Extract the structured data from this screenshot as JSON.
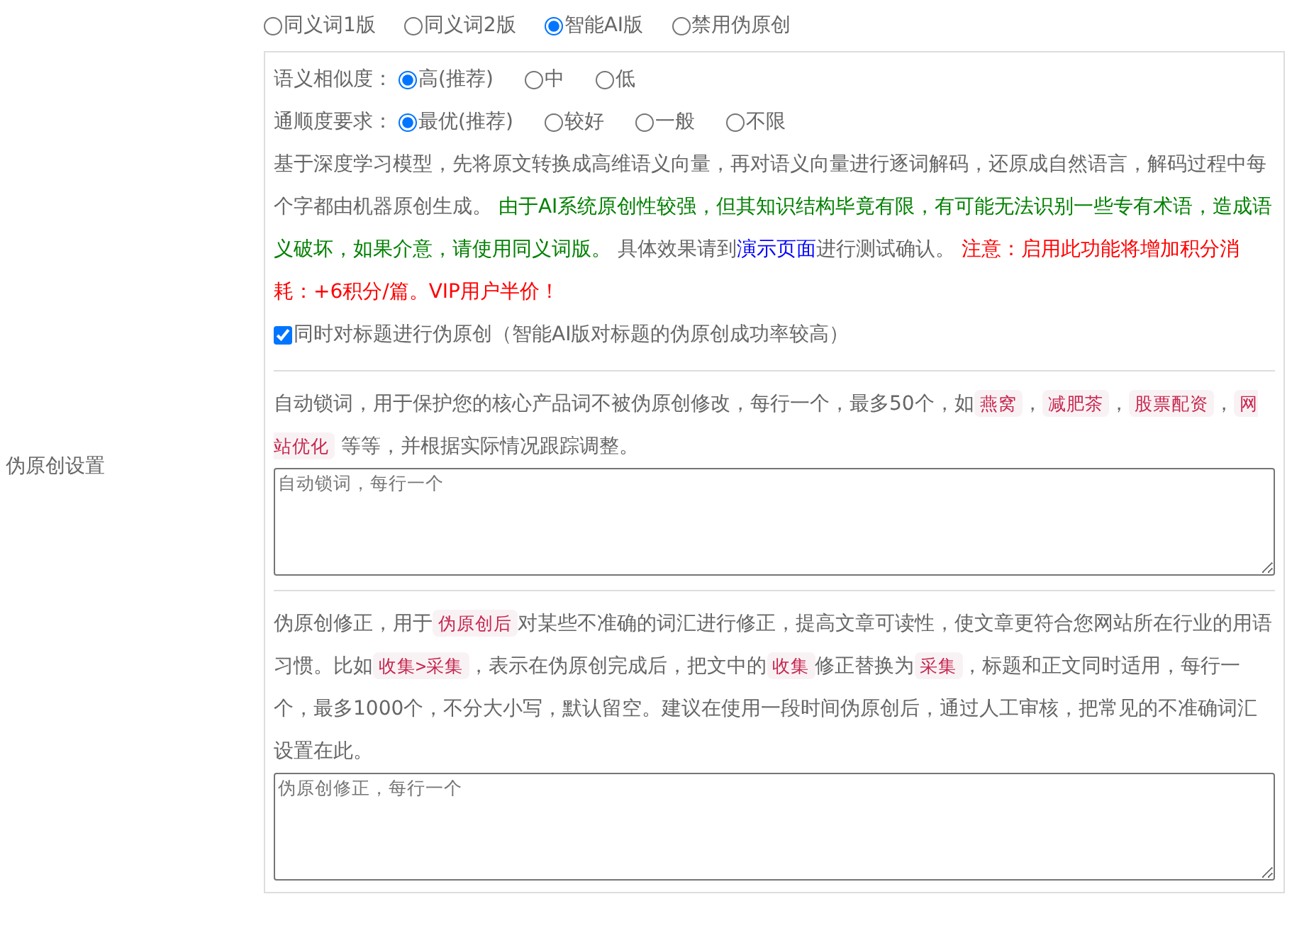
{
  "settings_label": "伪原创设置",
  "modes": [
    {
      "label": "同义词1版",
      "selected": false
    },
    {
      "label": "同义词2版",
      "selected": false
    },
    {
      "label": "智能AI版",
      "selected": true
    },
    {
      "label": "禁用伪原创",
      "selected": false
    }
  ],
  "similarity": {
    "label": "语义相似度：",
    "options": [
      {
        "label": "高(推荐)",
        "selected": true
      },
      {
        "label": "中",
        "selected": false
      },
      {
        "label": "低",
        "selected": false
      }
    ]
  },
  "fluency": {
    "label": "通顺度要求：",
    "options": [
      {
        "label": "最优(推荐)",
        "selected": true
      },
      {
        "label": "较好",
        "selected": false
      },
      {
        "label": "一般",
        "selected": false
      },
      {
        "label": "不限",
        "selected": false
      }
    ]
  },
  "description": [
    {
      "kind": "plain",
      "text": "基于深度学习模型，先将原文转换成高维语义向量，再对语义向量进行逐词解码，还原成自然语言，解码过程中每个字都由机器原创生成。 "
    },
    {
      "kind": "green",
      "text": "由于AI系统原创性较强，但其知识结构毕竟有限，有可能无法识别一些专有术语，造成语义破坏，如果介意，请使用同义词版。"
    },
    {
      "kind": "plain",
      "text": " 具体效果请到"
    },
    {
      "kind": "link",
      "text": "演示页面"
    },
    {
      "kind": "plain",
      "text": "进行测试确认。 "
    },
    {
      "kind": "red",
      "text": "注意：启用此功能将增加积分消耗：+6积分/篇。VIP用户半价！"
    }
  ],
  "title_option": {
    "label": "同时对标题进行伪原创（智能AI版对标题的伪原创成功率较高）",
    "checked": true
  },
  "lock_words": {
    "description": [
      {
        "kind": "plain",
        "text": "自动锁词，用于保护您的核心产品词不被伪原创修改，每行一个，最多50个，如"
      },
      {
        "kind": "code",
        "text": "燕窝"
      },
      {
        "kind": "plain",
        "text": "，"
      },
      {
        "kind": "code",
        "text": "减肥茶"
      },
      {
        "kind": "plain",
        "text": "，"
      },
      {
        "kind": "code",
        "text": "股票配资"
      },
      {
        "kind": "plain",
        "text": "，"
      },
      {
        "kind": "code",
        "text": "网站优化"
      },
      {
        "kind": "plain",
        "text": " 等等，并根据实际情况跟踪调整。"
      }
    ],
    "placeholder": "自动锁词，每行一个"
  },
  "correction": {
    "description": [
      {
        "kind": "plain",
        "text": "伪原创修正，用于"
      },
      {
        "kind": "code",
        "text": "伪原创后"
      },
      {
        "kind": "plain",
        "text": "对某些不准确的词汇进行修正，提高文章可读性，使文章更符合您网站所在行业的用语习惯。比如"
      },
      {
        "kind": "code",
        "text": "收集>采集"
      },
      {
        "kind": "plain",
        "text": "，表示在伪原创完成后，把文中的"
      },
      {
        "kind": "code",
        "text": "收集"
      },
      {
        "kind": "plain",
        "text": "修正替换为"
      },
      {
        "kind": "code",
        "text": "采集"
      },
      {
        "kind": "plain",
        "text": "，标题和正文同时适用，每行一个，最多1000个，不分大小写，默认留空。建议在使用一段时间伪原创后，通过人工审核，把常见的不准确词汇设置在此。"
      }
    ],
    "placeholder": "伪原创修正，每行一个"
  }
}
